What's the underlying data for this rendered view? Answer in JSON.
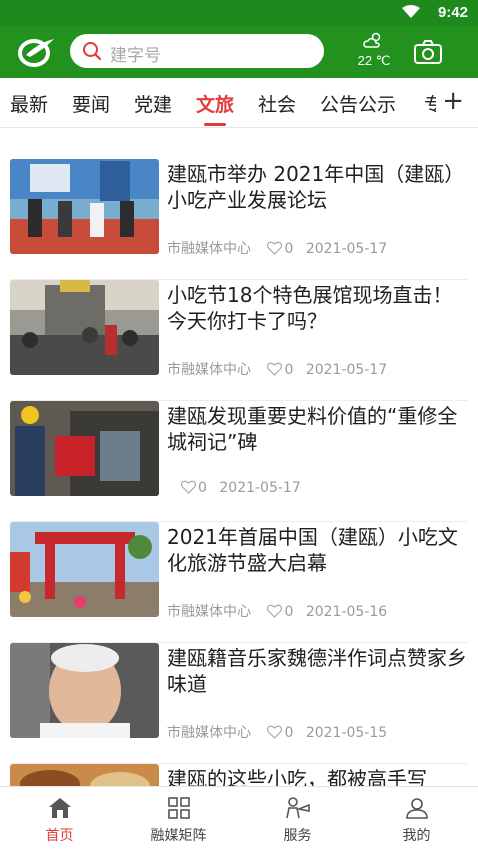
{
  "status_bar": {
    "time": "9:42"
  },
  "header": {
    "search_placeholder": "建字号",
    "weather": {
      "temp": "22 ℃",
      "icon": "partly-cloudy-icon"
    },
    "camera_icon": "camera-icon"
  },
  "tabs": [
    {
      "label": "最新"
    },
    {
      "label": "要闻"
    },
    {
      "label": "党建"
    },
    {
      "label": "文旅",
      "active": true
    },
    {
      "label": "社会"
    },
    {
      "label": "公告公示"
    },
    {
      "label": "专"
    }
  ],
  "tabs_more": "+",
  "news": [
    {
      "title": "建瓯市举办 2021年中国（建瓯）小吃产业发展论坛",
      "source": "市融媒体中心",
      "likes": "0",
      "date": "2021-05-17"
    },
    {
      "title": "小吃节18个特色展馆现场直击！今天你打卡了吗？",
      "source": "市融媒体中心",
      "likes": "0",
      "date": "2021-05-17"
    },
    {
      "title": "建瓯发现重要史料价值的“重修全城祠记”碑",
      "source": "",
      "likes": "0",
      "date": "2021-05-17"
    },
    {
      "title": "2021年首届中国（建瓯）小吃文化旅游节盛大启幕",
      "source": "市融媒体中心",
      "likes": "0",
      "date": "2021-05-16"
    },
    {
      "title": "建瓯籍音乐家魏德泮作词点赞家乡味道",
      "source": "市融媒体中心",
      "likes": "0",
      "date": "2021-05-15"
    },
    {
      "title": "建瓯的这些小吃，都被高手写",
      "source": "",
      "likes": "",
      "date": ""
    }
  ],
  "bottom_nav": [
    {
      "label": "首页",
      "icon": "home-icon",
      "active": true
    },
    {
      "label": "融媒矩阵",
      "icon": "grid-icon"
    },
    {
      "label": "服务",
      "icon": "service-icon"
    },
    {
      "label": "我的",
      "icon": "user-icon"
    }
  ],
  "colors": {
    "brand_green": "#22911e",
    "accent_red": "#e23b3b"
  }
}
